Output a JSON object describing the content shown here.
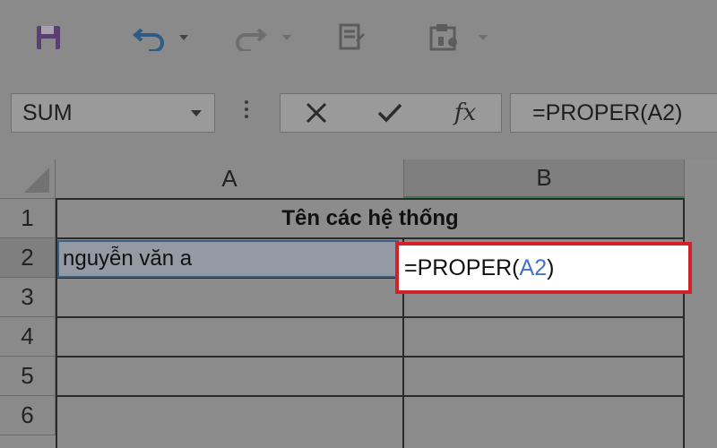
{
  "toolbar": {
    "buttons": [
      {
        "name": "save-icon"
      },
      {
        "name": "undo-icon"
      },
      {
        "name": "redo-icon"
      },
      {
        "name": "form-icon"
      },
      {
        "name": "sheet-tools-icon"
      }
    ]
  },
  "formula_bar": {
    "name_box": "SUM",
    "formula": "=PROPER(A2)",
    "fx_label": "fx"
  },
  "grid": {
    "columns": [
      "A",
      "B"
    ],
    "rows": [
      "1",
      "2",
      "3",
      "4",
      "5",
      "6"
    ],
    "merged_title": "Tên các hệ thống",
    "a2": "nguyễn văn a",
    "b2": {
      "prefix": "=PROPER(",
      "ref": "A2",
      "suffix": ")"
    }
  },
  "colors": {
    "highlight_border": "#d2212a",
    "cell_ref": "#4472c4",
    "active_col_underline": "#3f7a4e"
  }
}
